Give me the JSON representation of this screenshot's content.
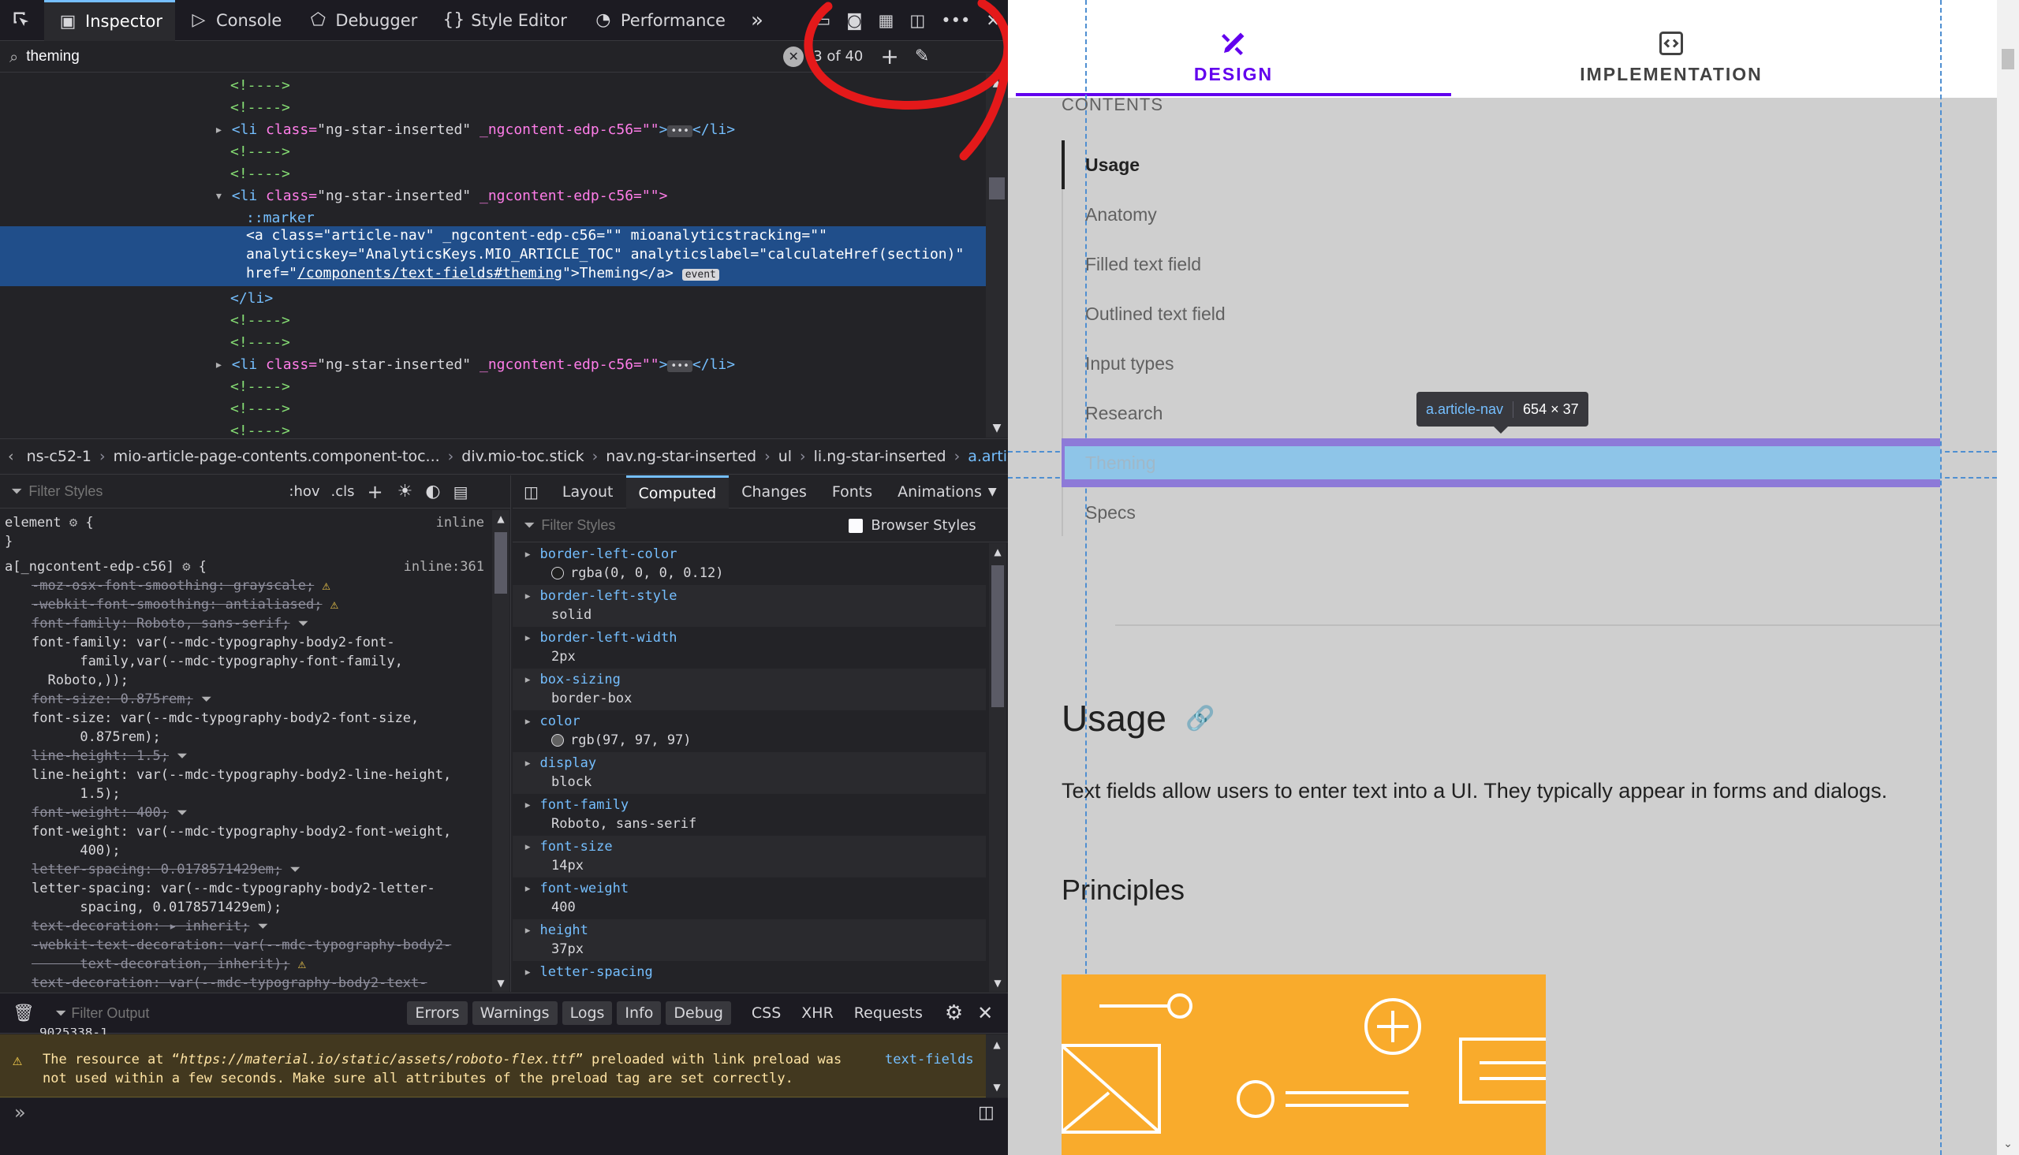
{
  "devtools": {
    "toolbar": {
      "tabs": [
        {
          "label": "Inspector"
        },
        {
          "label": "Console"
        },
        {
          "label": "Debugger"
        },
        {
          "label": "Style Editor"
        },
        {
          "label": "Performance"
        }
      ]
    },
    "search": {
      "value": "theming",
      "count": "3 of 40"
    },
    "markup_lines": {
      "c1": "<!---->",
      "c2": "<!---->",
      "l3_tag_open": "<li ",
      "l3_attr": "class=",
      "l3_val": "\"ng-star-inserted\"",
      "l3_attr2": " _ngcontent-edp-c56=\"\"",
      "l3_close": "</li>",
      "c4": "<!---->",
      "c5": "<!---->",
      "l6_tag_open": "<li ",
      "l6_attr": "class=",
      "l6_val": "\"ng-star-inserted\"",
      "l6_attr2": " _ngcontent-edp-c56=\"\">",
      "marker": "::marker",
      "sel1": "<a class=\"article-nav\" _ngcontent-edp-c56=\"\" mioanalyticstracking=\"\"",
      "sel2": "analyticskey=\"AnalyticsKeys.MIO_ARTICLE_TOC\" analyticslabel=\"calculateHref(section)\"",
      "sel3a": "href=\"",
      "sel3link": "/components/text-fields#theming",
      "sel3b": "\">Theming</a>",
      "event_badge": "event",
      "endli": "</li>",
      "c10": "<!---->",
      "c11": "<!---->",
      "l12_tag_open": "<li ",
      "l12_attr": "class=",
      "l12_val": "\"ng-star-inserted\"",
      "l12_attr2": " _ngcontent-edp-c56=\"\"",
      "l12_close": "</li>",
      "c13": "<!---->",
      "c14": "<!---->",
      "c15": "<!---->"
    },
    "breadcrumbs": [
      "ns-c52-1",
      "mio-article-page-contents.component-toc...",
      "div.mio-toc.stick",
      "nav.ng-star-inserted",
      "ul",
      "li.ng-star-inserted",
      "a.article-nav"
    ],
    "rules": {
      "filter_placeholder": "Filter Styles",
      "hov": ":hov",
      "cls": ".cls",
      "element_selector": "element",
      "element_source": "inline",
      "rule_selector": "a[_ngcontent-edp-c56]",
      "rule_source": "inline:361",
      "lines": [
        {
          "text": "-moz-osx-font-smoothing: grayscale;",
          "struck": true,
          "warn": true
        },
        {
          "text": "-webkit-font-smoothing: antialiased;",
          "struck": true,
          "warn": true
        },
        {
          "text": "font-family: Roboto, sans-serif;",
          "struck": true,
          "filter": true
        },
        {
          "text": "font-family: var(--mdc-typography-body2-font-",
          "struck": false
        },
        {
          "text": "      family,var(--mdc-typography-font-family,",
          "struck": false
        },
        {
          "text": "  Roboto,));",
          "struck": false
        },
        {
          "text": "font-size: 0.875rem;",
          "struck": true,
          "filter": true
        },
        {
          "text": "font-size: var(--mdc-typography-body2-font-size,",
          "struck": false
        },
        {
          "text": "      0.875rem);",
          "struck": false
        },
        {
          "text": "line-height: 1.5;",
          "struck": true,
          "filter": true
        },
        {
          "text": "line-height: var(--mdc-typography-body2-line-height,",
          "struck": false
        },
        {
          "text": "      1.5);",
          "struck": false
        },
        {
          "text": "font-weight: 400;",
          "struck": true,
          "filter": true
        },
        {
          "text": "font-weight: var(--mdc-typography-body2-font-weight,",
          "struck": false
        },
        {
          "text": "      400);",
          "struck": false
        },
        {
          "text": "letter-spacing: 0.0178571429em;",
          "struck": true,
          "filter": true
        },
        {
          "text": "letter-spacing: var(--mdc-typography-body2-letter-",
          "struck": false
        },
        {
          "text": "      spacing, 0.0178571429em);",
          "struck": false
        },
        {
          "text": "text-decoration: ▸ inherit;",
          "struck": true,
          "filter": true
        },
        {
          "text": "-webkit-text-decoration: var(--mdc-typography-body2-",
          "struck": true
        },
        {
          "text": "      text-decoration, inherit);",
          "struck": true,
          "warn": true
        },
        {
          "text": "text-decoration: var(--mdc-typography-body2-text-",
          "struck": true
        }
      ]
    },
    "computed": {
      "tabs": [
        "Layout",
        "Computed",
        "Changes",
        "Fonts",
        "Animations"
      ],
      "filter_placeholder": "Filter Styles",
      "browser_styles": "Browser Styles",
      "props": [
        {
          "name": "border-left-color",
          "value": "rgba(0, 0, 0, 0.12)",
          "swatch": "#1f1f1f"
        },
        {
          "name": "border-left-style",
          "value": "solid"
        },
        {
          "name": "border-left-width",
          "value": "2px"
        },
        {
          "name": "box-sizing",
          "value": "border-box"
        },
        {
          "name": "color",
          "value": "rgb(97, 97, 97)",
          "swatch": "#616161"
        },
        {
          "name": "display",
          "value": "block"
        },
        {
          "name": "font-family",
          "value": "Roboto, sans-serif"
        },
        {
          "name": "font-size",
          "value": "14px"
        },
        {
          "name": "font-weight",
          "value": "400"
        },
        {
          "name": "height",
          "value": "37px"
        },
        {
          "name": "letter-spacing",
          "value": ""
        }
      ]
    },
    "console": {
      "filter_placeholder": "Filter Output",
      "levels": [
        "Errors",
        "Warnings",
        "Logs",
        "Info",
        "Debug"
      ],
      "types": [
        "CSS",
        "XHR",
        "Requests"
      ],
      "truncated_line": "9025338-1",
      "warning_a": "The resource at “",
      "warning_url": "https://material.io/static/assets/roboto-flex.ttf",
      "warning_b": "” preloaded with link preload was",
      "warning_line2": "not used within a few seconds. Make sure all attributes of the preload tag are set correctly.",
      "warning_source": "text-fields"
    }
  },
  "page": {
    "tabs": [
      {
        "label": "DESIGN",
        "icon": "design-tools-icon",
        "active": true
      },
      {
        "label": "IMPLEMENTATION",
        "icon": "code-icon",
        "active": false
      }
    ],
    "contents_label": "CONTENTS",
    "toc": [
      "Usage",
      "Anatomy",
      "Filled text field",
      "Outlined text field",
      "Input types",
      "Research",
      "Theming",
      "Specs"
    ],
    "tooltip": {
      "selector": "a.article-nav",
      "size": "654 × 37"
    },
    "section_title": "Usage",
    "body_text": "Text fields allow users to enter text into a UI. They typically appear in forms and dialogs.",
    "subheading": "Principles",
    "colors": {
      "accent": "#6200ee",
      "highlight": "#8ec5e8",
      "illustration": "#f9ab2c"
    }
  }
}
